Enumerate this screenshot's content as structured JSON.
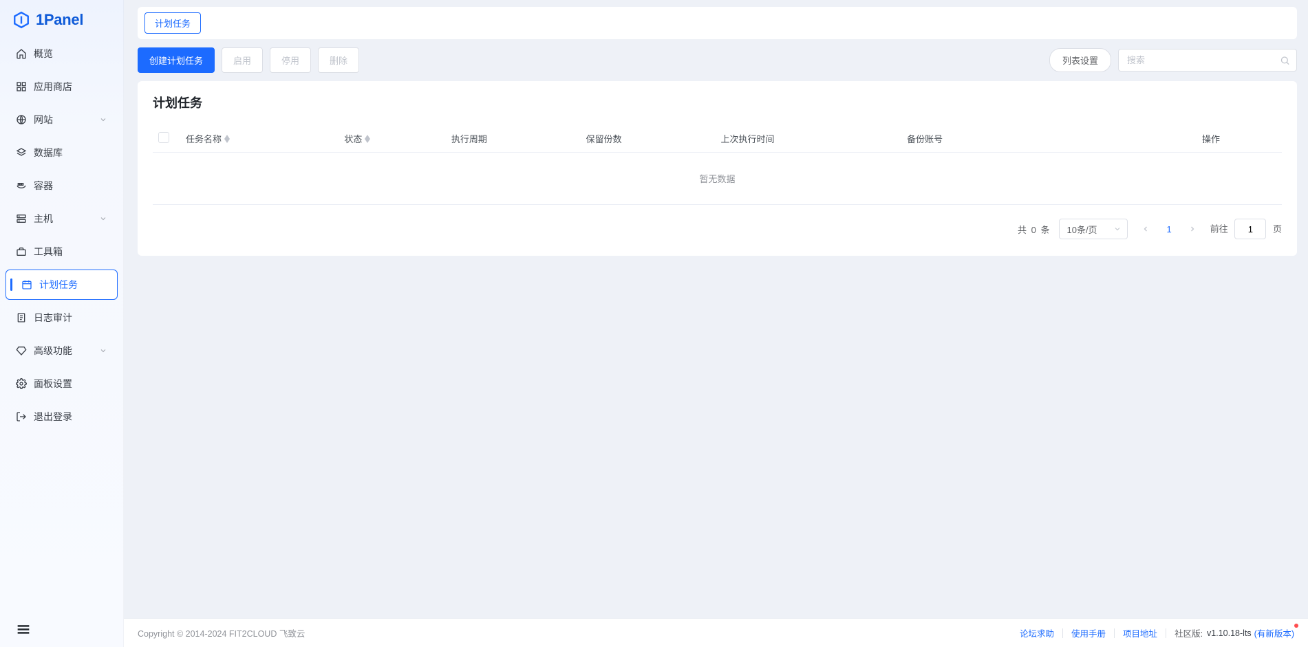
{
  "brand": "1Panel",
  "sidebar": {
    "items": [
      {
        "label": "概览",
        "icon": "home-icon",
        "expandable": false
      },
      {
        "label": "应用商店",
        "icon": "grid-icon",
        "expandable": false
      },
      {
        "label": "网站",
        "icon": "globe-icon",
        "expandable": true
      },
      {
        "label": "数据库",
        "icon": "layers-icon",
        "expandable": false
      },
      {
        "label": "容器",
        "icon": "container-icon",
        "expandable": false
      },
      {
        "label": "主机",
        "icon": "server-icon",
        "expandable": true
      },
      {
        "label": "工具箱",
        "icon": "toolbox-icon",
        "expandable": false
      },
      {
        "label": "计划任务",
        "icon": "calendar-icon",
        "expandable": false,
        "active": true
      },
      {
        "label": "日志审计",
        "icon": "log-icon",
        "expandable": false
      },
      {
        "label": "高级功能",
        "icon": "diamond-icon",
        "expandable": true
      },
      {
        "label": "面板设置",
        "icon": "gear-icon",
        "expandable": false
      },
      {
        "label": "退出登录",
        "icon": "logout-icon",
        "expandable": false
      }
    ]
  },
  "tabs": {
    "active": "计划任务"
  },
  "toolbar": {
    "create": "创建计划任务",
    "enable": "启用",
    "disable": "停用",
    "delete": "删除",
    "list_settings": "列表设置",
    "search_placeholder": "搜索"
  },
  "card": {
    "title": "计划任务"
  },
  "table": {
    "columns": [
      "任务名称",
      "状态",
      "执行周期",
      "保留份数",
      "上次执行时间",
      "备份账号",
      "操作"
    ],
    "empty": "暂无数据"
  },
  "pagination": {
    "total_prefix": "共",
    "total_count": "0",
    "total_suffix": "条",
    "page_size": "10条/页",
    "current": "1",
    "goto_prefix": "前往",
    "goto_value": "1",
    "goto_suffix": "页"
  },
  "footer": {
    "copyright": "Copyright © 2014-2024 FIT2CLOUD 飞致云",
    "links": [
      "论坛求助",
      "使用手册",
      "项目地址"
    ],
    "edition_label": "社区版:",
    "version": "v1.10.18-lts",
    "new_version": "(有新版本)"
  }
}
